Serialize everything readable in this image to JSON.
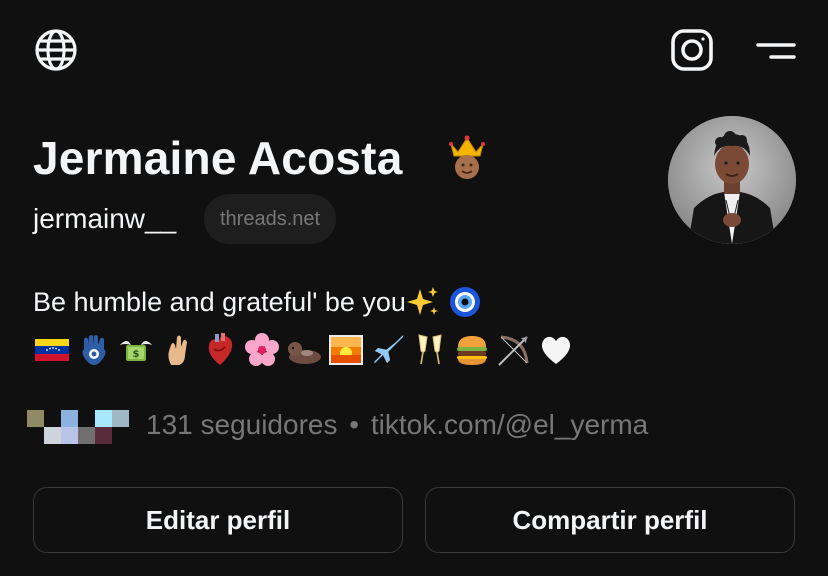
{
  "header": {
    "left_icon": "globe-icon",
    "right_icons": [
      "instagram-icon",
      "menu-icon"
    ]
  },
  "profile": {
    "name": "Jermaine Acosta",
    "name_emoji": "crown-emoji",
    "username": "jermainw__",
    "domain_badge": "threads.net",
    "bio_line1": "Be humble and grateful' be you",
    "bio_line1_emojis": [
      "sparkles-emoji",
      "nazar-amulet-emoji"
    ],
    "bio_emoji_row": [
      "venezuela-flag-emoji",
      "hamsa-emoji",
      "money-with-wings-emoji",
      "crossed-fingers-emoji",
      "anatomical-heart-emoji",
      "cherry-blossom-emoji",
      "otter-emoji",
      "sunrise-emoji",
      "airplane-emoji",
      "champagne-glasses-emoji",
      "hamburger-emoji",
      "bow-and-arrow-emoji",
      "white-heart-emoji"
    ],
    "followers_text": "131 seguidores",
    "separator": "•",
    "link": "tiktok.com/@el_yerma"
  },
  "buttons": {
    "edit": "Editar perfil",
    "share": "Compartir perfil"
  },
  "colors": {
    "background": "#101010",
    "primary_text": "#f3f5f7",
    "secondary_text": "#777777",
    "button_border": "#3a3a3a",
    "pill_bg": "#1e1e1e"
  }
}
